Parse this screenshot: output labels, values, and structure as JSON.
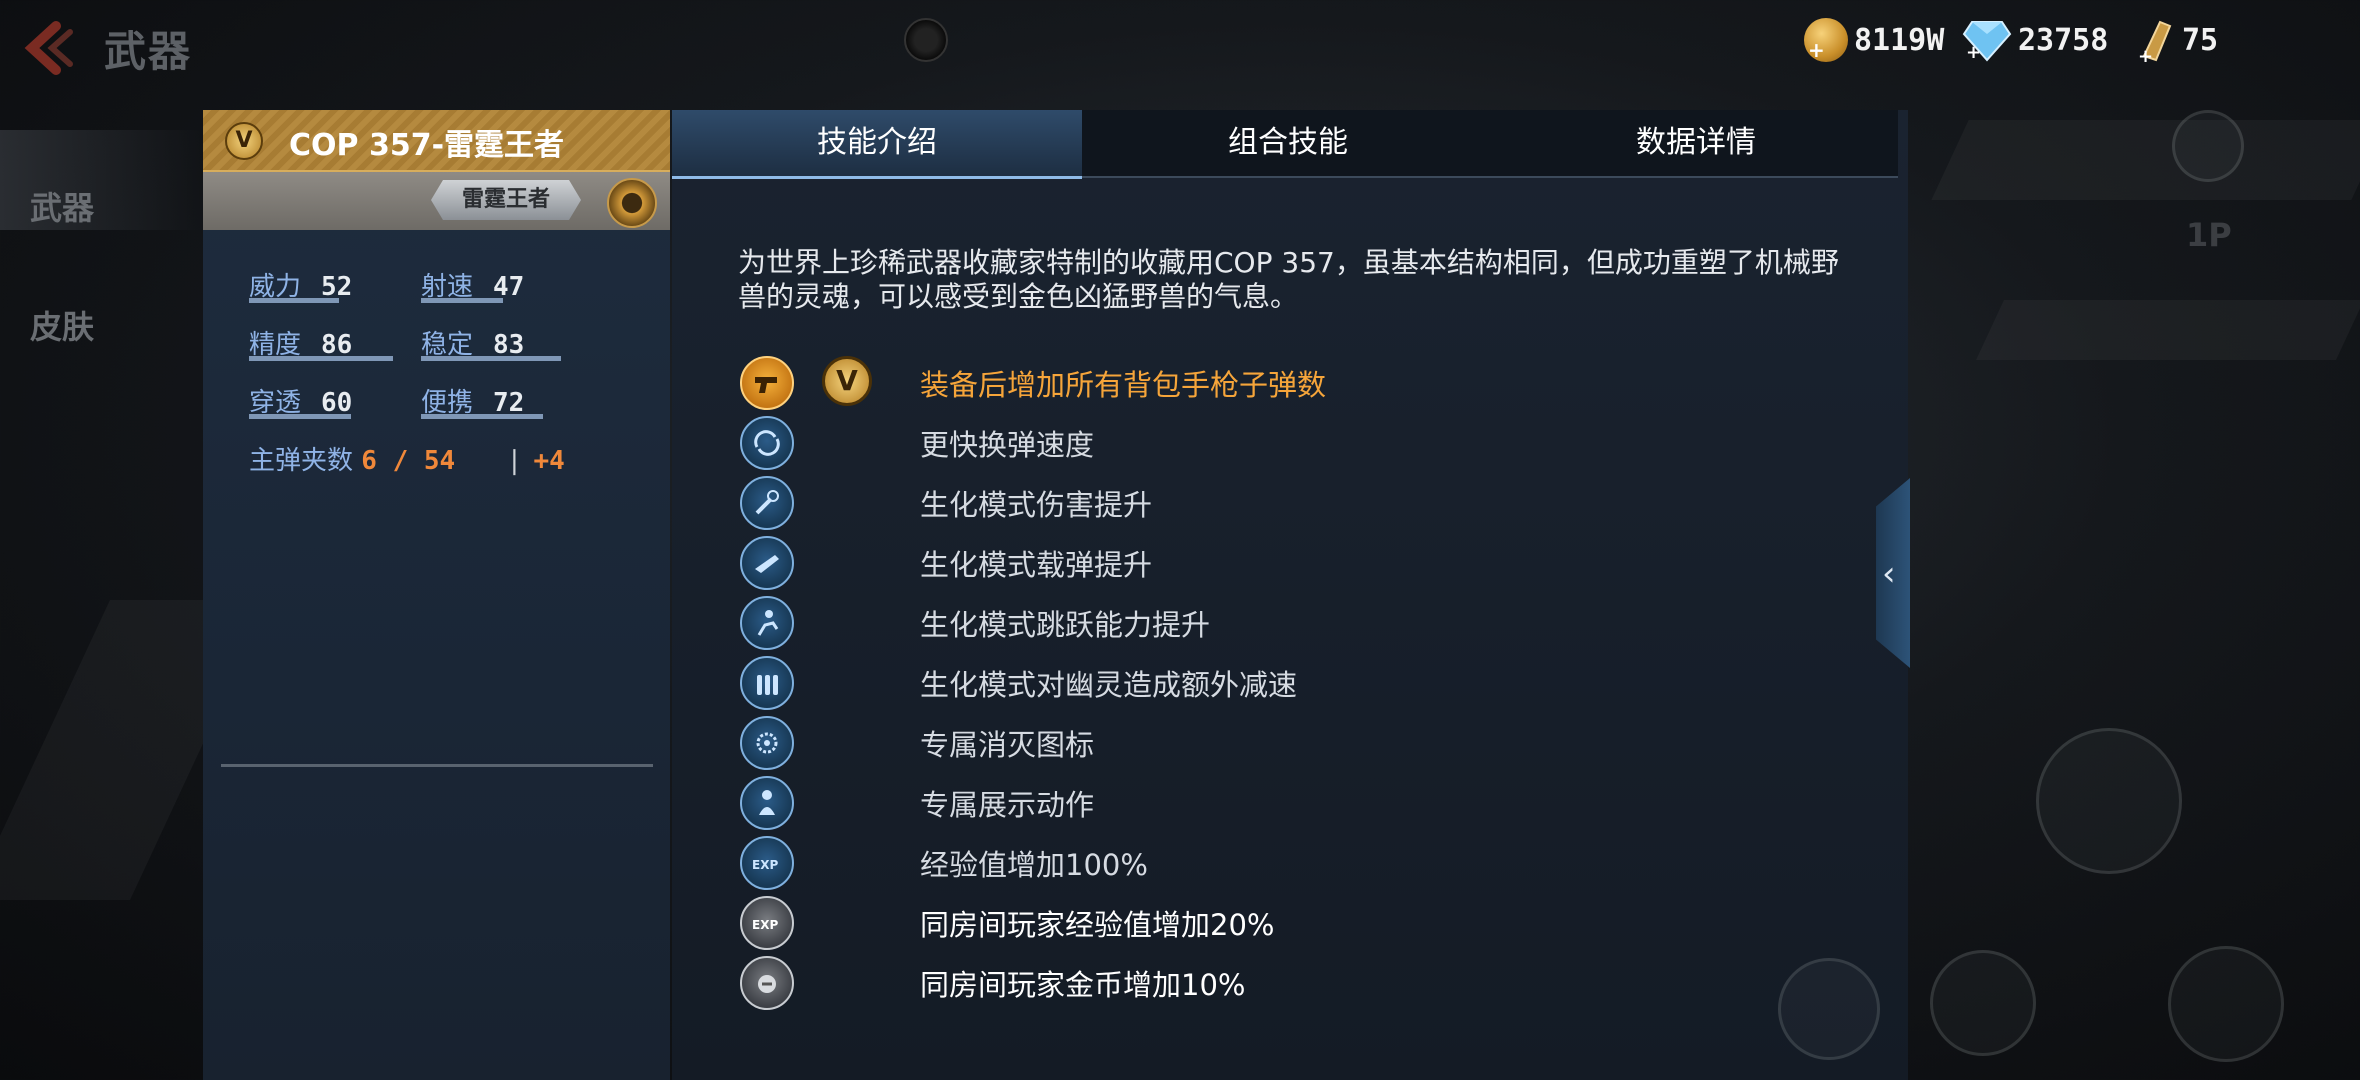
{
  "page_title": "武器",
  "currencies": [
    {
      "name": "gold",
      "value": "8119W"
    },
    {
      "name": "diamond",
      "value": "23758"
    },
    {
      "name": "ticket",
      "value": "75"
    }
  ],
  "left_nav": {
    "weapons": "武器",
    "skins": "皮肤"
  },
  "weapon": {
    "name": "COP 357-雷霆王者",
    "skin_plate": "雷霆王者",
    "badge": "V",
    "stats": [
      {
        "label": "威力",
        "value": "52"
      },
      {
        "label": "射速",
        "value": "47"
      },
      {
        "label": "精度",
        "value": "86"
      },
      {
        "label": "稳定",
        "value": "83"
      },
      {
        "label": "穿透",
        "value": "60"
      },
      {
        "label": "便携",
        "value": "72"
      }
    ],
    "ammo_label": "主弹夹数",
    "ammo_value": "6 / 54",
    "ammo_bonus": "+4"
  },
  "tabs": [
    {
      "label": "技能介绍",
      "active": true
    },
    {
      "label": "组合技能",
      "active": false
    },
    {
      "label": "数据详情",
      "active": false
    }
  ],
  "description": "为世界上珍稀武器收藏家特制的收藏用COP 357，虽基本结构相同，但成功重塑了机械野兽的灵魂，可以感受到金色凶猛野兽的气息。",
  "skills": [
    {
      "icon": "pistol-icon",
      "text": "装备后增加所有背包手枪子弹数"
    },
    {
      "icon": "reload-icon",
      "text": "更快换弹速度"
    },
    {
      "icon": "damage-icon",
      "text": "生化模式伤害提升"
    },
    {
      "icon": "rifle-icon",
      "text": "生化模式载弹提升"
    },
    {
      "icon": "jump-icon",
      "text": "生化模式跳跃能力提升"
    },
    {
      "icon": "bullets-icon",
      "text": "生化模式对幽灵造成额外减速"
    },
    {
      "icon": "kill-mark-icon",
      "text": "专属消灭图标"
    },
    {
      "icon": "pose-icon",
      "text": "专属展示动作"
    },
    {
      "icon": "exp-icon",
      "text": "经验值增加100%"
    },
    {
      "icon": "room-exp-icon",
      "text": "同房间玩家经验值增加20%"
    },
    {
      "icon": "room-coin-icon",
      "text": "同房间玩家金币增加10%"
    }
  ],
  "skill_v_badge": "V",
  "colors": {
    "accent_orange": "#f6a53a",
    "tab_active": "#2f4b6a",
    "stat_label": "#8fb3e6"
  }
}
